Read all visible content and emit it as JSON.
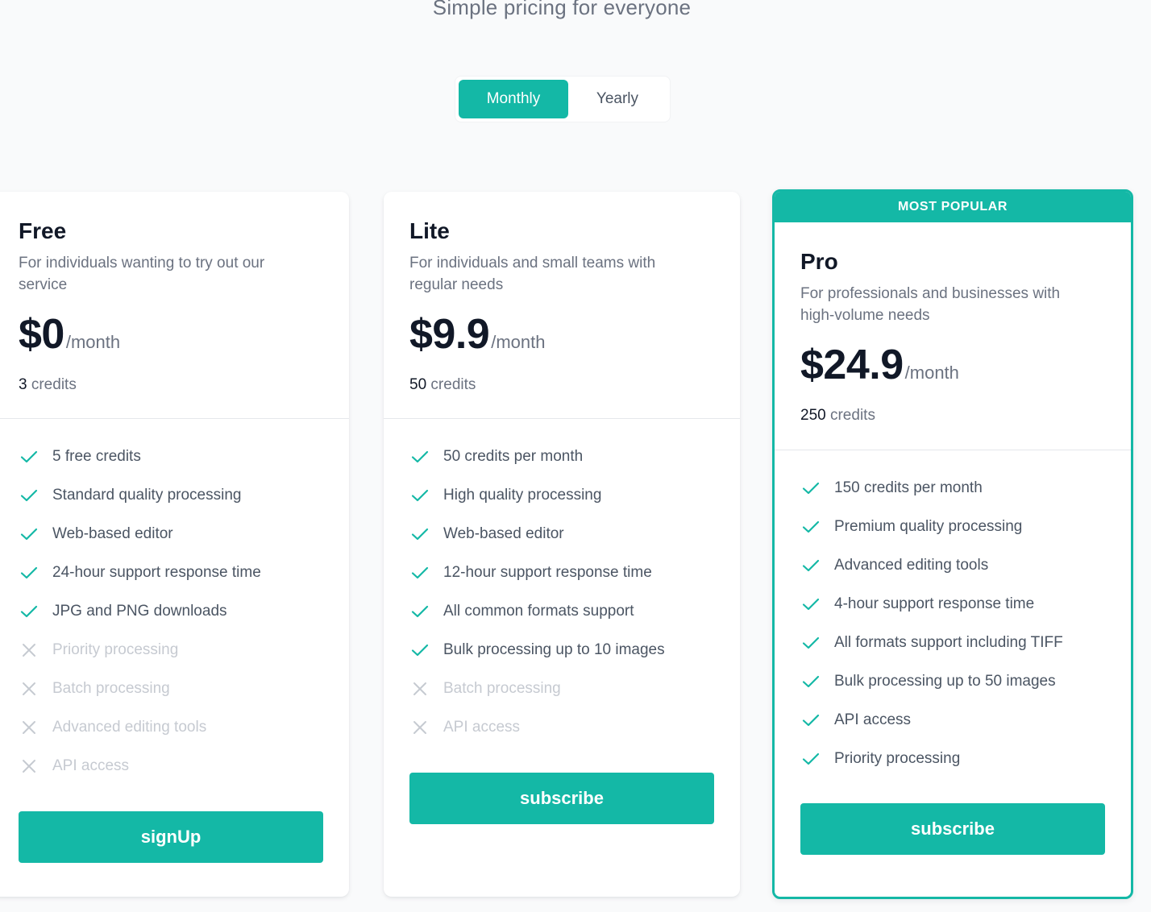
{
  "header": {
    "subtitle": "Simple pricing for everyone"
  },
  "billing_toggle": {
    "options": [
      {
        "label": "Monthly",
        "active": true
      },
      {
        "label": "Yearly",
        "active": false
      }
    ]
  },
  "colors": {
    "accent": "#14b8a6",
    "text_primary": "#111827",
    "text_secondary": "#6b7280",
    "disabled": "#c6cad1",
    "page_background": "#f9fafb"
  },
  "plans": [
    {
      "name": "Free",
      "description": "For individuals wanting to try out our service",
      "price": "$0",
      "period": "/month",
      "credits_number": "3",
      "credits_label": "credits",
      "features": [
        {
          "text": "5 free credits",
          "included": true,
          "icon": "check-icon"
        },
        {
          "text": "Standard quality processing",
          "included": true,
          "icon": "check-icon"
        },
        {
          "text": "Web-based editor",
          "included": true,
          "icon": "check-icon"
        },
        {
          "text": "24-hour support response time",
          "included": true,
          "icon": "check-icon"
        },
        {
          "text": "JPG and PNG downloads",
          "included": true,
          "icon": "check-icon"
        },
        {
          "text": "Priority processing",
          "included": false,
          "icon": "x-icon"
        },
        {
          "text": "Batch processing",
          "included": false,
          "icon": "x-icon"
        },
        {
          "text": "Advanced editing tools",
          "included": false,
          "icon": "x-icon"
        },
        {
          "text": "API access",
          "included": false,
          "icon": "x-icon"
        }
      ],
      "cta_label": "signUp"
    },
    {
      "name": "Lite",
      "description": "For individuals and small teams with regular needs",
      "price": "$9.9",
      "period": "/month",
      "credits_number": "50",
      "credits_label": "credits",
      "features": [
        {
          "text": "50 credits per month",
          "included": true,
          "icon": "check-icon"
        },
        {
          "text": "High quality processing",
          "included": true,
          "icon": "check-icon"
        },
        {
          "text": "Web-based editor",
          "included": true,
          "icon": "check-icon"
        },
        {
          "text": "12-hour support response time",
          "included": true,
          "icon": "check-icon"
        },
        {
          "text": "All common formats support",
          "included": true,
          "icon": "check-icon"
        },
        {
          "text": "Bulk processing up to 10 images",
          "included": true,
          "icon": "check-icon"
        },
        {
          "text": "Batch processing",
          "included": false,
          "icon": "x-icon"
        },
        {
          "text": "API access",
          "included": false,
          "icon": "x-icon"
        }
      ],
      "cta_label": "subscribe"
    },
    {
      "name": "Pro",
      "badge": "MOST POPULAR",
      "description": "For professionals and businesses with high-volume needs",
      "price": "$24.9",
      "period": "/month",
      "credits_number": "250",
      "credits_label": "credits",
      "features": [
        {
          "text": "150 credits per month",
          "included": true,
          "icon": "check-icon"
        },
        {
          "text": "Premium quality processing",
          "included": true,
          "icon": "check-icon"
        },
        {
          "text": "Advanced editing tools",
          "included": true,
          "icon": "check-icon"
        },
        {
          "text": "4-hour support response time",
          "included": true,
          "icon": "check-icon"
        },
        {
          "text": "All formats support including TIFF",
          "included": true,
          "icon": "check-icon"
        },
        {
          "text": "Bulk processing up to 50 images",
          "included": true,
          "icon": "check-icon"
        },
        {
          "text": "API access",
          "included": true,
          "icon": "check-icon"
        },
        {
          "text": "Priority processing",
          "included": true,
          "icon": "check-icon"
        }
      ],
      "cta_label": "subscribe"
    }
  ]
}
